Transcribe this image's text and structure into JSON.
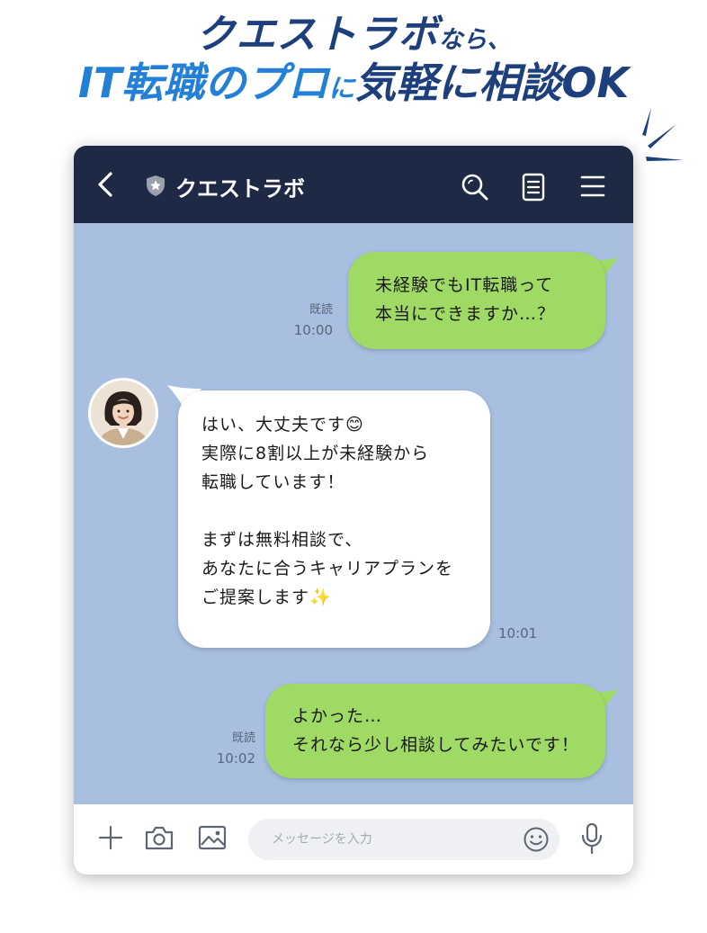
{
  "headline": {
    "line1_main": "クエストラボ",
    "line1_sub": "なら、",
    "line2_a": "IT転職のプロ",
    "line2_b": "に",
    "line2_c": "気軽に相談OK"
  },
  "chat": {
    "title": "クエストラボ",
    "colors": {
      "header": "#1d2945",
      "background": "#a8bfe0",
      "bubble_user": "#9fda65",
      "bubble_agent": "#ffffff"
    },
    "messages": [
      {
        "sender": "user",
        "text": "未経験でもIT転職って\n本当にできますか…？",
        "read": "既読",
        "time": "10:00"
      },
      {
        "sender": "agent",
        "text": "はい、大丈夫です😊\n実際に8割以上が未経験から\n転職しています！\n\nまずは無料相談で、\nあなたに合うキャリアプランを\nご提案します✨",
        "time": "10:01"
      },
      {
        "sender": "user",
        "text": "よかった…\nそれなら少し相談してみたいです！",
        "read": "既読",
        "time": "10:02"
      }
    ],
    "input": {
      "placeholder": "メッセージを入力"
    },
    "icons": {
      "back": "back-chevron-icon",
      "verified": "shield-star-icon",
      "search": "search-icon",
      "notes": "notes-icon",
      "menu": "menu-icon",
      "plus": "plus-icon",
      "camera": "camera-icon",
      "image": "image-icon",
      "emoji": "emoji-icon",
      "mic": "microphone-icon"
    }
  }
}
